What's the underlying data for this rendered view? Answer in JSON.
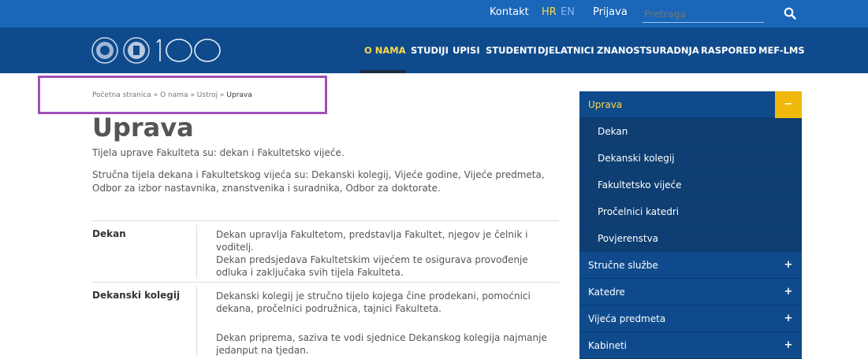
{
  "topbar": {
    "links": [
      {
        "name": "kontakt-link",
        "label": "Kontakt"
      },
      {
        "name": "lang-hr",
        "label": "HR"
      },
      {
        "name": "lang-en",
        "label": "EN"
      },
      {
        "name": "prijava-link",
        "label": "Prijava"
      }
    ],
    "search_placeholder": "Pretraga",
    "search_icon": "search-icon"
  },
  "nav": {
    "logo_text": "100",
    "items": [
      "O NAMA",
      "STUDIJI",
      "UPISI",
      "STUDENTI",
      "DJELATNICI",
      "ZNANOST",
      "SURADNJA",
      "RASPORED",
      "MEF-LMS"
    ],
    "active_index": 0
  },
  "breadcrumb": {
    "items": [
      "Početna stranica",
      "O nama",
      "Ustroj"
    ],
    "separator": "»",
    "current": "Uprava"
  },
  "main": {
    "title": "Uprava",
    "intro1": "Tijela uprave Fakulteta su: dekan i Fakultetsko vijeće.",
    "intro2": "Stručna tijela dekana i Fakultetskog vijeća su: Dekanski kolegij, Vijeće godine, Vijeće predmeta, Odbor za izbor nastavnika, znanstvenika i suradnika, Odbor za doktorate.",
    "rows": [
      {
        "label": "Dekan",
        "paragraphs": [
          "Dekan upravlja Fakultetom, predstavlja Fakultet, njegov je čelnik i voditelj.",
          "Dekan predsjedava Fakultetskim vijećem te osigurava provođenje odluka i zaključaka svih tijela Fakulteta."
        ]
      },
      {
        "label": "Dekanski kolegij",
        "paragraphs": [
          "Dekanski kolegij je stručno tijelo kojega čine prodekani, pomoćnici dekana, pročelnici podružnica, tajnici Fakulteta.",
          "Dekan priprema, saziva te vodi sjednice Dekanskog kolegija najmanje jedanput na tjedan."
        ]
      }
    ]
  },
  "sidebar": {
    "items": [
      {
        "label": "Uprava",
        "toggle": "−",
        "active": true,
        "sub": false
      },
      {
        "label": "Dekan",
        "sub": true
      },
      {
        "label": "Dekanski kolegij",
        "sub": true
      },
      {
        "label": "Fakultetsko vijeće",
        "sub": true
      },
      {
        "label": "Pročelnici katedri",
        "sub": true
      },
      {
        "label": "Povjerenstva",
        "sub": true
      },
      {
        "label": "Stručne službe",
        "toggle": "+",
        "sub": false
      },
      {
        "label": "Katedre",
        "toggle": "+",
        "sub": false
      },
      {
        "label": "Vijeća predmeta",
        "toggle": "+",
        "sub": false
      },
      {
        "label": "Kabineti",
        "toggle": "+",
        "sub": false
      }
    ]
  },
  "colors": {
    "topbar": "#1a66b8",
    "navbar": "#0f4b8c",
    "accent": "#ffd84a",
    "toggle_active": "#f0b90b"
  }
}
